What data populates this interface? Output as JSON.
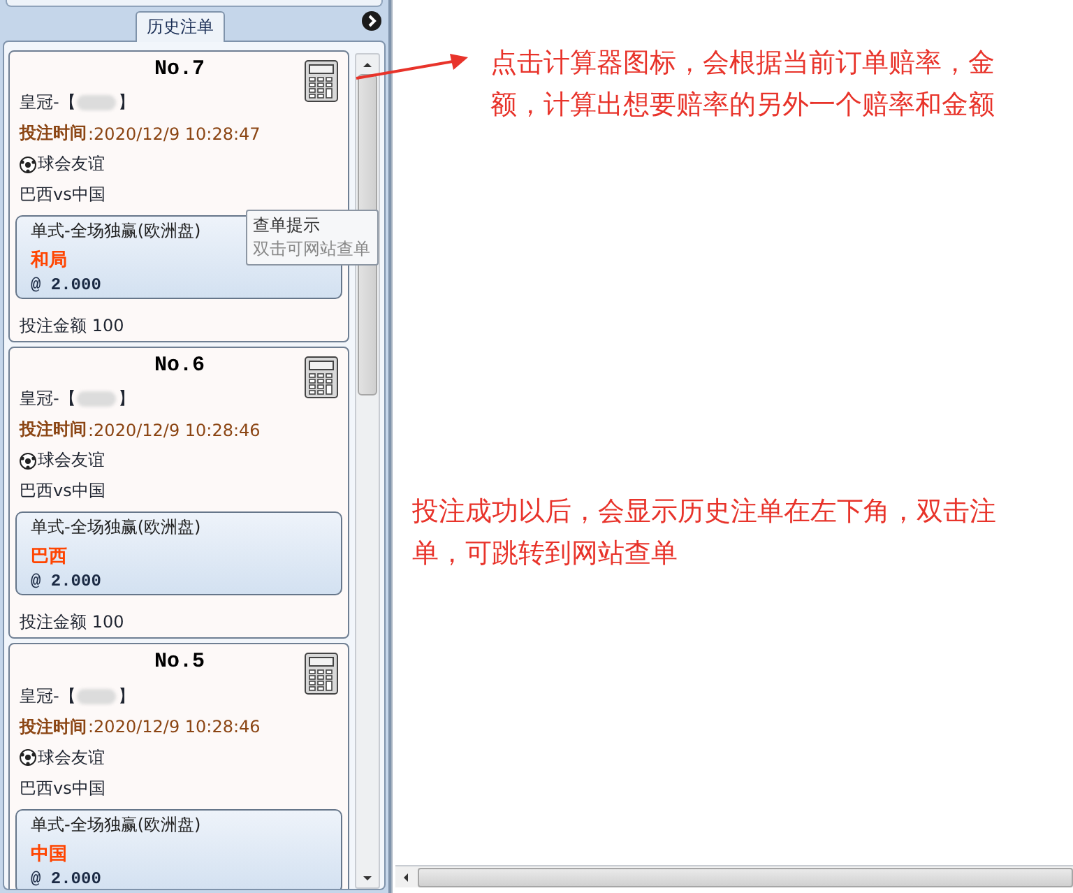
{
  "panel": {
    "title": "历史注单"
  },
  "orders": [
    {
      "number": "No.7",
      "account_prefix": "皇冠-【",
      "account_suffix": "】",
      "time": "**投注时间**:2020/12/9 10:28:47",
      "league": "球会友谊",
      "match": "巴西vs中国",
      "bet_type": "单式-全场独赢(欧洲盘)",
      "selection": "和局",
      "odds": "@ 2.000",
      "amount": "投注金额 100"
    },
    {
      "number": "No.6",
      "account_prefix": "皇冠-【",
      "account_suffix": "】",
      "time": "**投注时间**:2020/12/9 10:28:46",
      "league": "球会友谊",
      "match": "巴西vs中国",
      "bet_type": "单式-全场独赢(欧洲盘)",
      "selection": "巴西",
      "odds": "@ 2.000",
      "amount": "投注金额 100"
    },
    {
      "number": "No.5",
      "account_prefix": "皇冠-【",
      "account_suffix": "】",
      "time": "**投注时间**:2020/12/9 10:28:46",
      "league": "球会友谊",
      "match": "巴西vs中国",
      "bet_type": "单式-全场独赢(欧洲盘)",
      "selection": "中国",
      "odds": "@ 2.000"
    }
  ],
  "tooltip": {
    "title": "查单提示",
    "text": "双击可网站查单"
  },
  "annotations": [
    "点击计算器图标，会根据当前订单赔率，金额，计算出想要赔率的另外一个赔率和金额",
    "投注成功以后，会显示历史注单在左下角，双击注单，可跳转到网站查单"
  ]
}
